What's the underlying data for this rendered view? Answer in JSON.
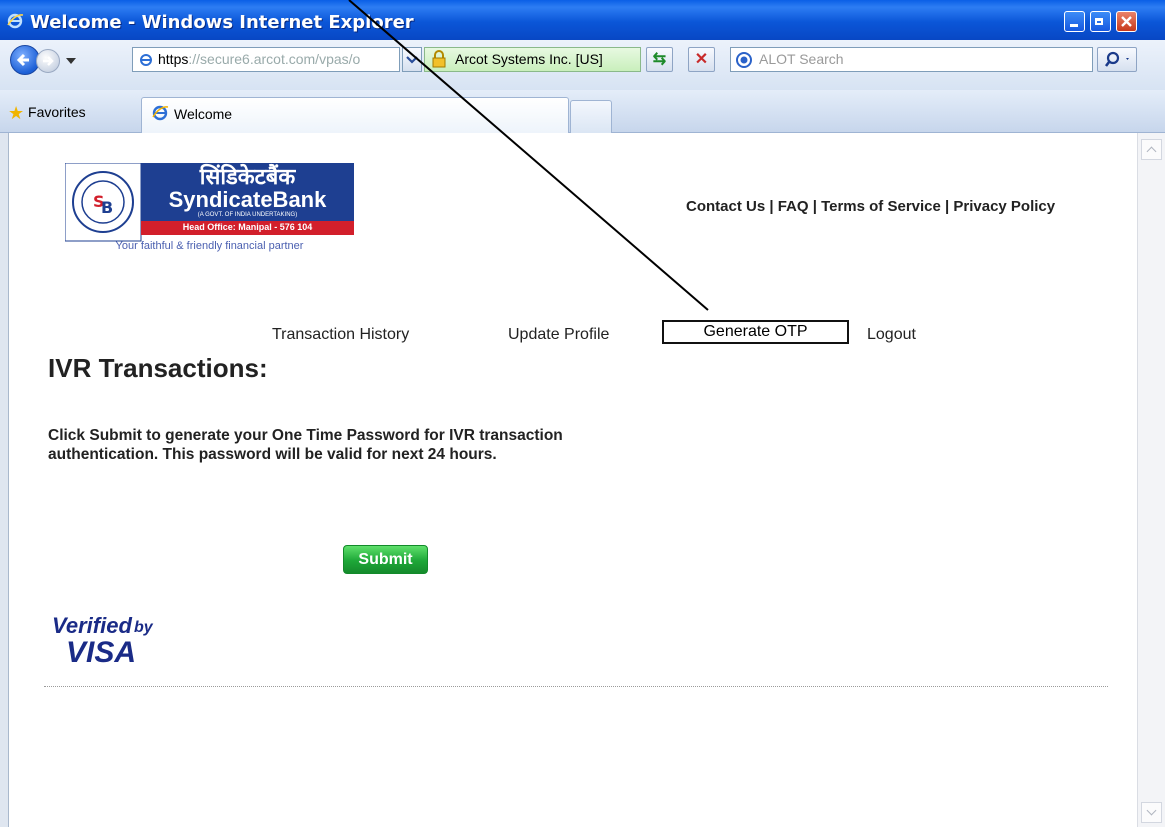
{
  "window": {
    "title": "Welcome - Windows Internet Explorer",
    "buttons": [
      "minimize",
      "restore",
      "close"
    ]
  },
  "navbar": {
    "address_https": "https",
    "address_rest": "://secure6.arcot.com/vpas/o",
    "security_label": "Arcot Systems Inc. [US]",
    "search_placeholder": "ALOT Search",
    "icons": [
      "back-icon",
      "forward-icon",
      "refresh-icon",
      "stop-icon",
      "search-icon",
      "lock-icon"
    ]
  },
  "favorites": {
    "label": "Favorites",
    "tab_title": "Welcome"
  },
  "page": {
    "bank_name_hindi": "सिंडिकेटबैंक",
    "bank_name": "SyndicateBank",
    "bank_sub": "(A GOVT. OF INDIA UNDERTAKING)",
    "head_office": "Head Office: Manipal - 576 104",
    "tagline": "Your faithful & friendly financial partner",
    "top_links": "Contact Us | FAQ | Terms of Service | Privacy Policy",
    "nav": {
      "transaction_history": "Transaction History",
      "update_profile": "Update Profile",
      "generate_otp": "Generate OTP",
      "logout": "Logout"
    },
    "heading": "IVR Transactions:",
    "desc_line1": "Click Submit to generate your One Time Password for IVR transaction",
    "desc_line2": "authentication. This password will be valid for next 24 hours.",
    "submit": "Submit",
    "verified_by": "Verified",
    "verified_by_small": "by",
    "visa": "VISA"
  },
  "colors": {
    "titlebar": "#0b56d8",
    "bank_blue": "#1e3f91",
    "bank_red": "#d21f2b",
    "submit_green": "#1ea738",
    "visa_blue": "#1a2b87"
  }
}
